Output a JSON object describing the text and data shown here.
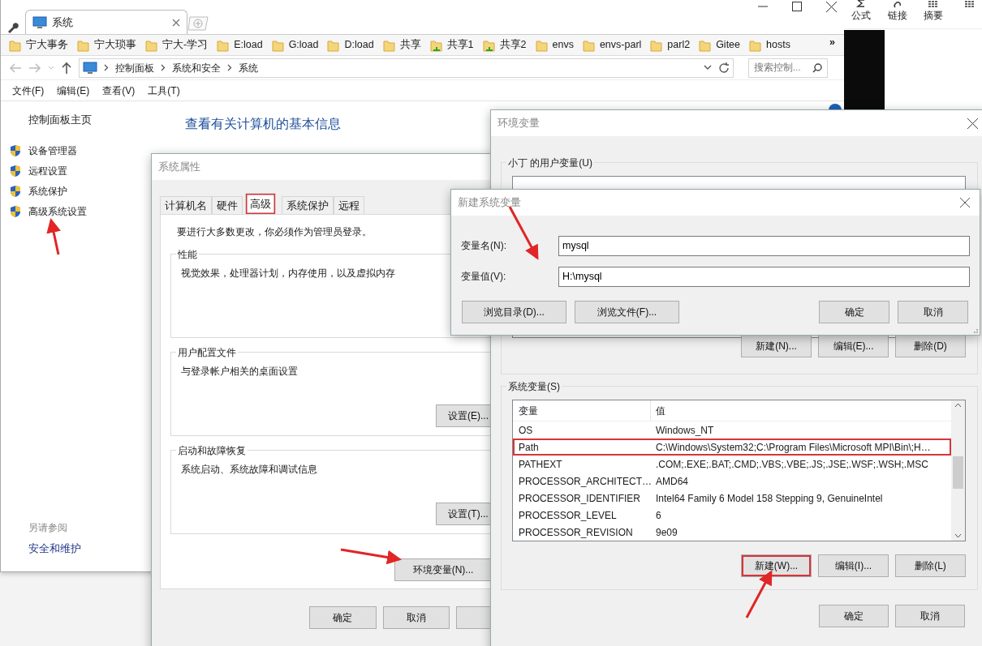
{
  "browser": {
    "tab_title": "系统",
    "bookmarks": [
      {
        "label": "宁大事务",
        "kind": "folder"
      },
      {
        "label": "宁大琐事",
        "kind": "folder"
      },
      {
        "label": "宁大-学习",
        "kind": "folder"
      },
      {
        "label": "E:load",
        "kind": "folder"
      },
      {
        "label": "G:load",
        "kind": "folder"
      },
      {
        "label": "D:load",
        "kind": "folder"
      },
      {
        "label": "共享",
        "kind": "folder"
      },
      {
        "label": "共享1",
        "kind": "share"
      },
      {
        "label": "共享2",
        "kind": "share"
      },
      {
        "label": "envs",
        "kind": "folder"
      },
      {
        "label": "envs-parl",
        "kind": "folder"
      },
      {
        "label": "parl2",
        "kind": "folder"
      },
      {
        "label": "Gitee",
        "kind": "folder"
      },
      {
        "label": "hosts",
        "kind": "folder"
      }
    ],
    "overflow": "»",
    "breadcrumbs": [
      "控制面板",
      "系统和安全",
      "系统"
    ],
    "search_placeholder": "搜索控制...",
    "menu": [
      "文件(F)",
      "编辑(E)",
      "查看(V)",
      "工具(T)"
    ]
  },
  "control_panel": {
    "home_link": "控制面板主页",
    "tasks": [
      "设备管理器",
      "远程设置",
      "系统保护",
      "高级系统设置"
    ],
    "heading": "查看有关计算机的基本信息",
    "see_also_title": "另请参阅",
    "see_also_links": [
      "安全和维护"
    ]
  },
  "side_app": {
    "tools": [
      "公式",
      "链接",
      "摘要"
    ]
  },
  "system_properties": {
    "title": "系统属性",
    "tabs": [
      {
        "label": "计算机名",
        "selected": false,
        "highlighted": false
      },
      {
        "label": "硬件",
        "selected": false,
        "highlighted": false
      },
      {
        "label": "高级",
        "selected": true,
        "highlighted": true
      },
      {
        "label": "系统保护",
        "selected": false,
        "highlighted": false
      },
      {
        "label": "远程",
        "selected": false,
        "highlighted": false
      }
    ],
    "notice": "要进行大多数更改，你必须作为管理员登录。",
    "groups": [
      {
        "title": "性能",
        "description": "视觉效果，处理器计划，内存使用，以及虚拟内存"
      },
      {
        "title": "用户配置文件",
        "description": "与登录帐户相关的桌面设置",
        "button": "设置(E)..."
      },
      {
        "title": "启动和故障恢复",
        "description": "系统启动、系统故障和调试信息",
        "button": "设置(T)..."
      }
    ],
    "env_button": "环境变量(N)...",
    "footer_buttons": [
      "确定",
      "取消"
    ]
  },
  "environment_variables": {
    "title": "环境变量",
    "user_group": {
      "title": "小丁 的用户变量(U)",
      "buttons": [
        {
          "label": "新建(N)..."
        },
        {
          "label": "编辑(E)..."
        },
        {
          "label": "删除(D)"
        }
      ]
    },
    "system_group": {
      "title": "系统变量(S)",
      "columns": [
        "变量",
        "值"
      ],
      "rows": [
        {
          "name": "OS",
          "value": "Windows_NT",
          "highlighted": false
        },
        {
          "name": "Path",
          "value": "C:\\Windows\\System32;C:\\Program Files\\Microsoft MPI\\Bin\\;H…",
          "highlighted": true
        },
        {
          "name": "PATHEXT",
          "value": ".COM;.EXE;.BAT;.CMD;.VBS;.VBE;.JS;.JSE;.WSF;.WSH;.MSC",
          "highlighted": false
        },
        {
          "name": "PROCESSOR_ARCHITECT…",
          "value": "AMD64",
          "highlighted": false
        },
        {
          "name": "PROCESSOR_IDENTIFIER",
          "value": "Intel64 Family 6 Model 158 Stepping 9, GenuineIntel",
          "highlighted": false
        },
        {
          "name": "PROCESSOR_LEVEL",
          "value": "6",
          "highlighted": false
        },
        {
          "name": "PROCESSOR_REVISION",
          "value": "9e09",
          "highlighted": false
        }
      ],
      "buttons": [
        {
          "label": "新建(W)...",
          "highlighted": true
        },
        {
          "label": "编辑(I)...",
          "highlighted": false
        },
        {
          "label": "删除(L)",
          "highlighted": false
        }
      ]
    },
    "footer_buttons": [
      "确定",
      "取消"
    ]
  },
  "new_variable_dialog": {
    "title": "新建系统变量",
    "fields": [
      {
        "label": "变量名(N):",
        "value": "mysql"
      },
      {
        "label": "变量值(V):",
        "value": "H:\\mysql"
      }
    ],
    "left_buttons": [
      "浏览目录(D)...",
      "浏览文件(F)..."
    ],
    "right_buttons": [
      "确定",
      "取消"
    ]
  }
}
